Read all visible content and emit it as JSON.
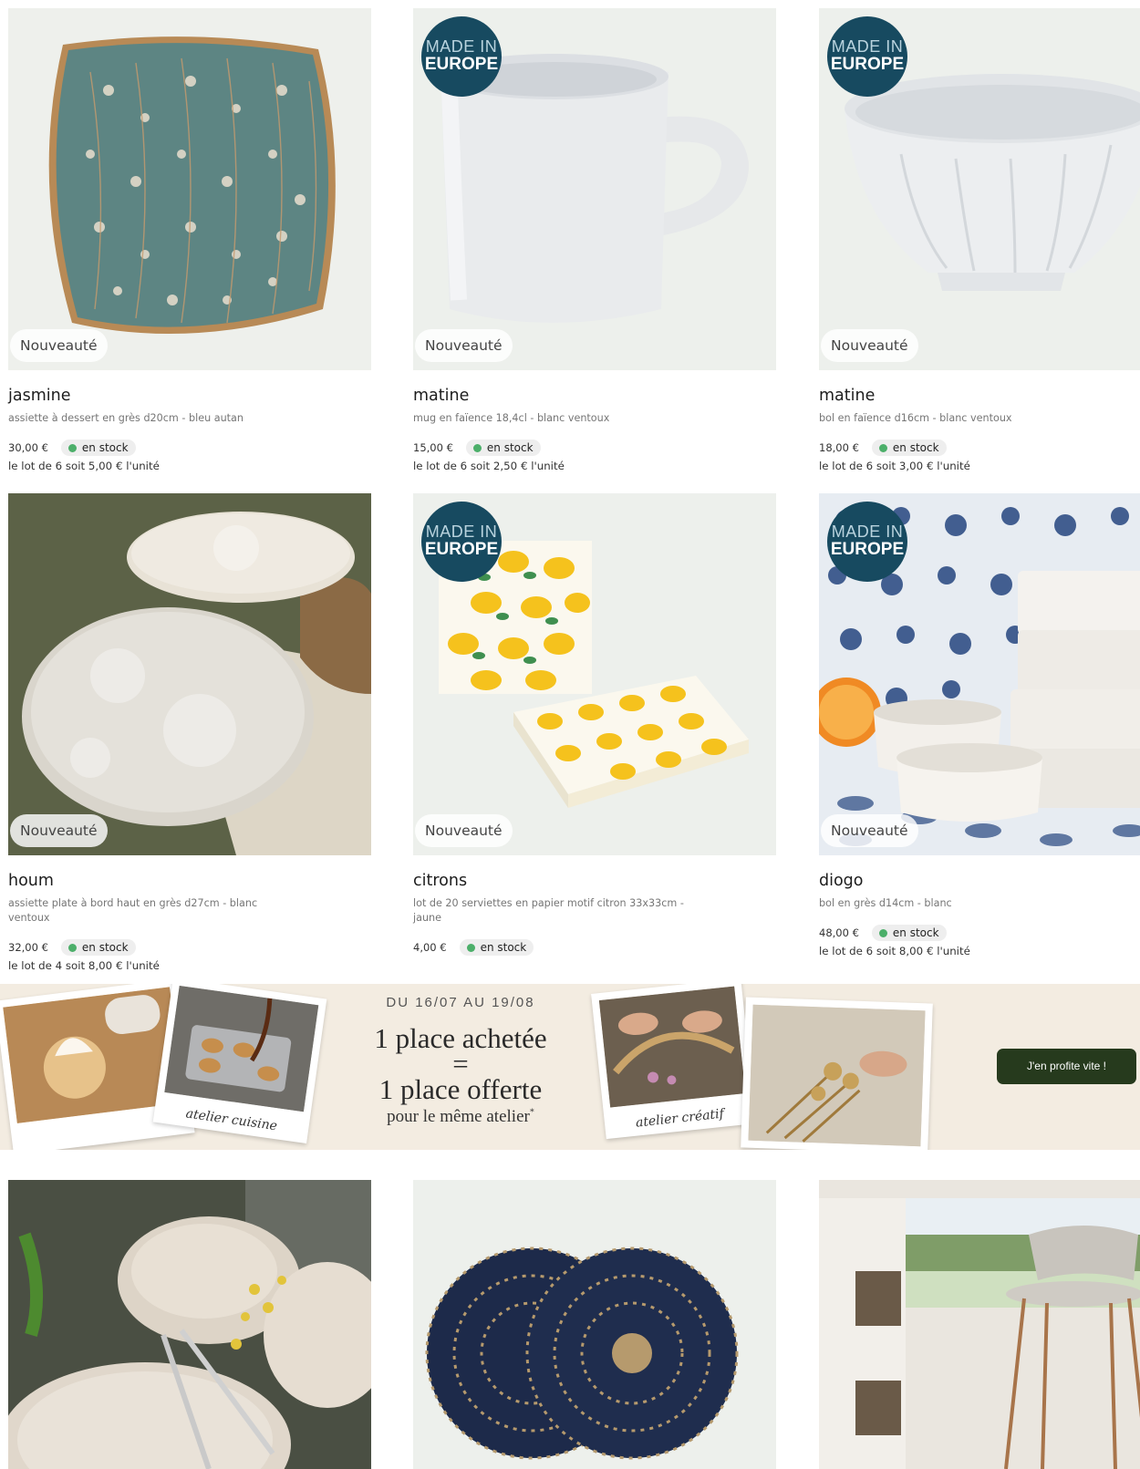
{
  "products": [
    {
      "name": "jasmine",
      "desc": "assiette à dessert en grès d20cm - bleu autan",
      "price": "30,00 €",
      "stock": "en stock",
      "lot": "le lot de 6 soit 5,00 € l'unité",
      "badge_new": "Nouveauté",
      "made_in_europe": false
    },
    {
      "name": "matine",
      "desc": "mug en faïence 18,4cl - blanc ventoux",
      "price": "15,00 €",
      "stock": "en stock",
      "lot": "le lot de 6 soit 2,50 € l'unité",
      "badge_new": "Nouveauté",
      "made_in_europe": true
    },
    {
      "name": "matine",
      "desc": "bol en faïence d16cm - blanc ventoux",
      "price": "18,00 €",
      "stock": "en stock",
      "lot": "le lot de 6 soit 3,00 € l'unité",
      "badge_new": "Nouveauté",
      "made_in_europe": true
    },
    {
      "name": "houm",
      "desc": "assiette plate à bord haut en grès d27cm - blanc ventoux",
      "price": "32,00 €",
      "stock": "en stock",
      "lot": "le lot de 4 soit 8,00 € l'unité",
      "badge_new": "Nouveauté",
      "made_in_europe": false
    },
    {
      "name": "citrons",
      "desc": "lot de 20 serviettes en papier motif citron 33x33cm - jaune",
      "price": "4,00 €",
      "stock": "en stock",
      "lot": "",
      "badge_new": "Nouveauté",
      "made_in_europe": true
    },
    {
      "name": "diogo",
      "desc": "bol en grès d14cm - blanc",
      "price": "48,00 €",
      "stock": "en stock",
      "lot": "le lot de 6 soit 8,00 € l'unité",
      "badge_new": "Nouveauté",
      "made_in_europe": true
    }
  ],
  "europe_badge": {
    "line1": "MADE IN",
    "line2": "EUROPE"
  },
  "banner": {
    "dates": "DU 16/07 AU 19/08",
    "line1": "1 place achetée",
    "equals": "=",
    "line2": "1 place offerte",
    "line3": "pour le même atelier",
    "asterisk": "*",
    "caption_left": "atelier cuisine",
    "caption_right": "atelier créatif",
    "cta": "J'en profite vite !"
  },
  "colors": {
    "europe_badge": "#174a60",
    "cta": "#263a1d",
    "stock_dot": "#4caf6a",
    "tile_bg": "#edf0ec"
  },
  "icons": [
    "stock-dot-icon"
  ]
}
